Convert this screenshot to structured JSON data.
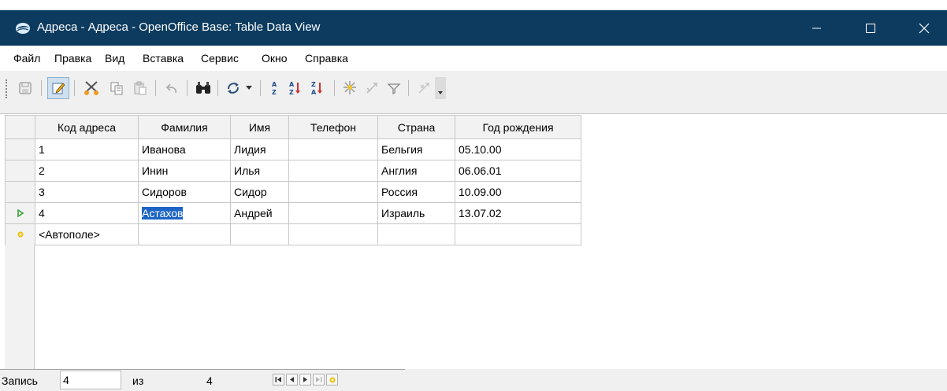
{
  "window": {
    "title": "Адреса - Адреса - OpenOffice Base: Table Data View"
  },
  "menu": {
    "items": [
      "Файл",
      "Правка",
      "Вид",
      "Вставка",
      "Сервис",
      "Окно",
      "Справка"
    ]
  },
  "toolbar": {
    "buttons": [
      "save-icon",
      "edit-data-icon",
      "cut-icon",
      "copy-icon",
      "paste-icon",
      "undo-icon",
      "find-icon",
      "refresh-icon",
      "dropdown-arrow-icon",
      "sort-icon",
      "sort-ascending-icon",
      "sort-descending-icon",
      "autofilter-icon",
      "standard-filter-icon",
      "apply-filter-icon",
      "remove-filter-icon",
      "toolbar-options-icon"
    ]
  },
  "grid": {
    "columns": [
      "Код адреса",
      "Фамилия",
      "Имя",
      "Телефон",
      "Страна",
      "Год рождения"
    ],
    "rows": [
      [
        "1",
        "Иванова",
        "Лидия",
        "",
        "Бельгия",
        "05.10.00"
      ],
      [
        "2",
        "Инин",
        "Илья",
        "",
        "Англия",
        "06.06.01"
      ],
      [
        "3",
        "Сидоров",
        "Сидор",
        "",
        "Россия",
        "10.09.00"
      ],
      [
        "4",
        "Астахов",
        "Андрей",
        "",
        "Израиль",
        "13.07.02"
      ]
    ],
    "new_row_value": "<Автополе>",
    "current_row": 4,
    "selected_cell_text": "Астахов"
  },
  "navigation": {
    "record_label": "Запись",
    "record_value": "4",
    "of_label": "из",
    "total": "4"
  },
  "colors": {
    "titlebar": "#0c3b5f",
    "selection": "#1c65c6",
    "current_row_marker": "#3aa03a",
    "new_row_marker": "#e8b400"
  }
}
